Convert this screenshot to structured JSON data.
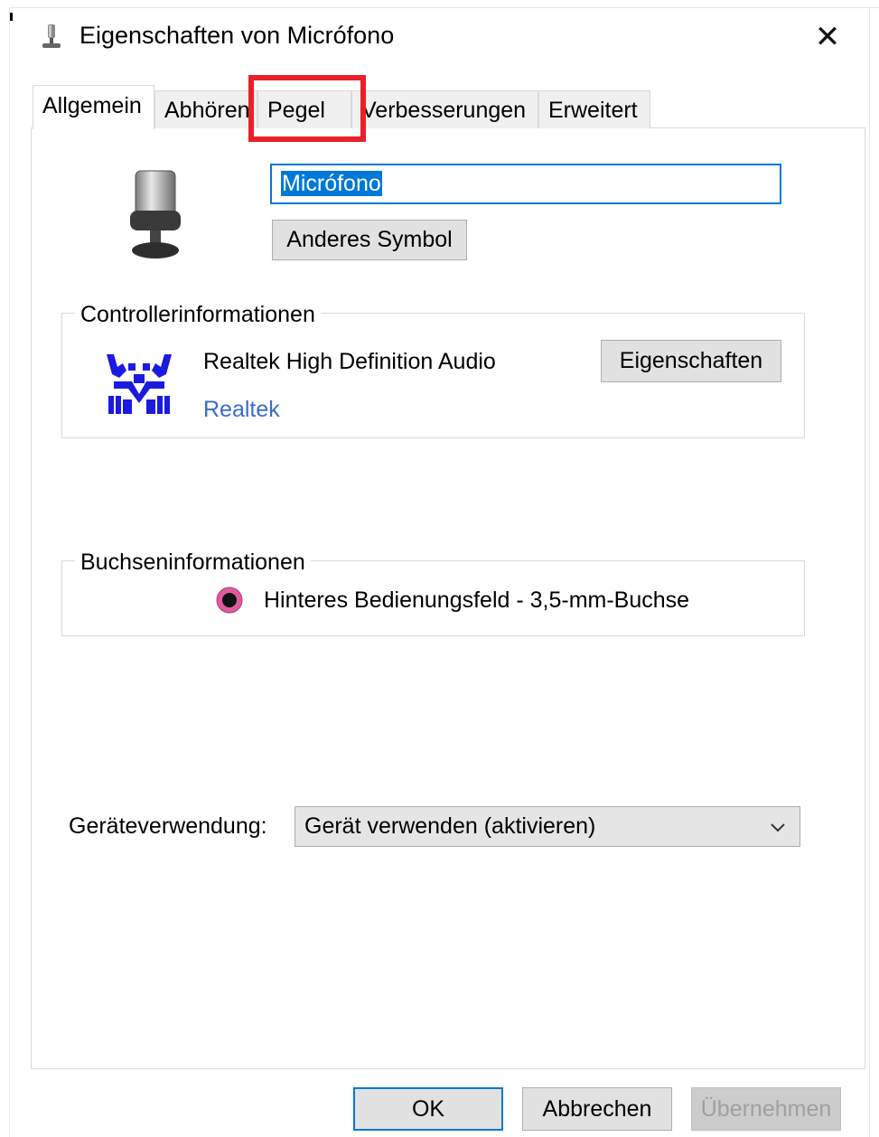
{
  "window": {
    "title": "Eigenschaften von Micrófono",
    "close_symbol": "✕"
  },
  "tabs": [
    {
      "label": "Allgemein",
      "active": true
    },
    {
      "label": "Abhören",
      "active": false
    },
    {
      "label": "Pegel",
      "active": false,
      "highlighted": true
    },
    {
      "label": "Verbesserungen",
      "active": false
    },
    {
      "label": "Erweitert",
      "active": false
    }
  ],
  "device": {
    "name_value": "Micrófono",
    "change_icon_label": "Anderes Symbol",
    "icon": "microphone-icon"
  },
  "controller": {
    "group_label": "Controllerinformationen",
    "name": "Realtek High Definition Audio",
    "vendor_link": "Realtek",
    "properties_button": "Eigenschaften",
    "icon": "realtek-logo-icon"
  },
  "jack": {
    "group_label": "Buchseninformationen",
    "description": "Hinteres Bedienungsfeld - 3,5-mm-Buchse",
    "jack_color": "#e05aa0",
    "icon": "jack-pink-icon"
  },
  "usage": {
    "label": "Geräteverwendung:",
    "selected": "Gerät verwenden (aktivieren)"
  },
  "footer": {
    "ok": "OK",
    "cancel": "Abbrechen",
    "apply": "Übernehmen"
  },
  "colors": {
    "accent": "#0078d7",
    "highlight_box": "#e8202a",
    "link": "#3a6bc9"
  }
}
